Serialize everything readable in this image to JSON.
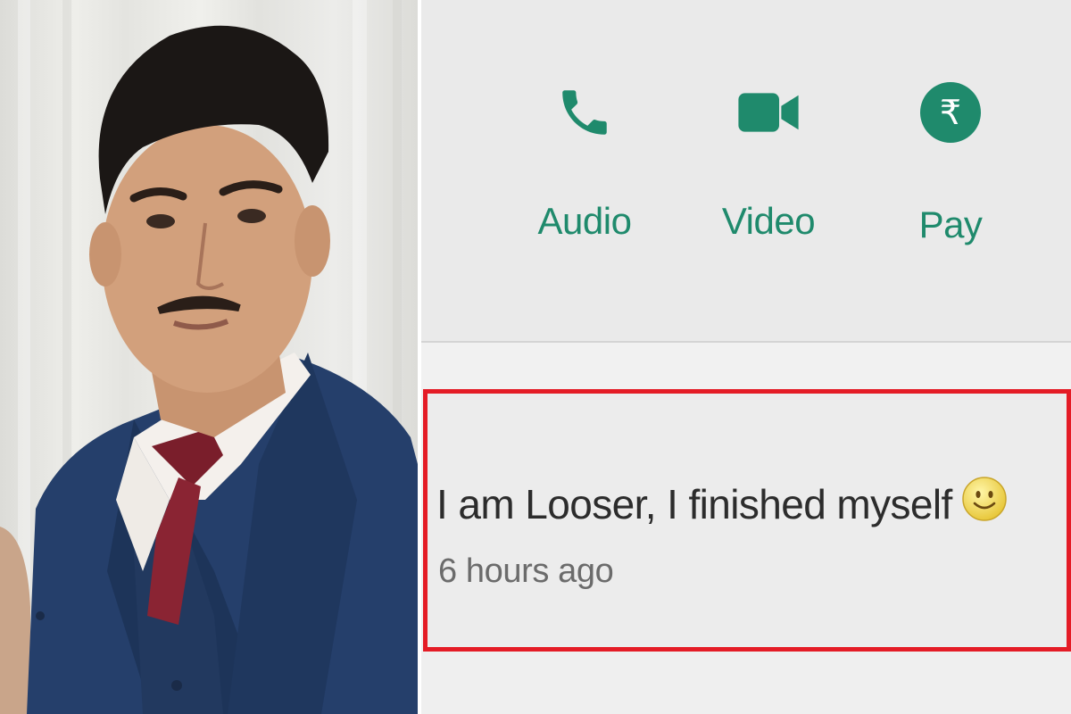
{
  "actions": {
    "audio": {
      "label": "Audio",
      "icon": "phone-icon"
    },
    "video": {
      "label": "Video",
      "icon": "video-camera-icon"
    },
    "pay": {
      "label": "Pay",
      "icon": "rupee-icon",
      "symbol": "₹"
    }
  },
  "status": {
    "text": "I am Looser, I finished myself",
    "emoji_icon": "smiley-face-icon",
    "time": "6 hours ago"
  },
  "colors": {
    "accent": "#1f8a6c",
    "highlight_border": "#e41c26"
  }
}
